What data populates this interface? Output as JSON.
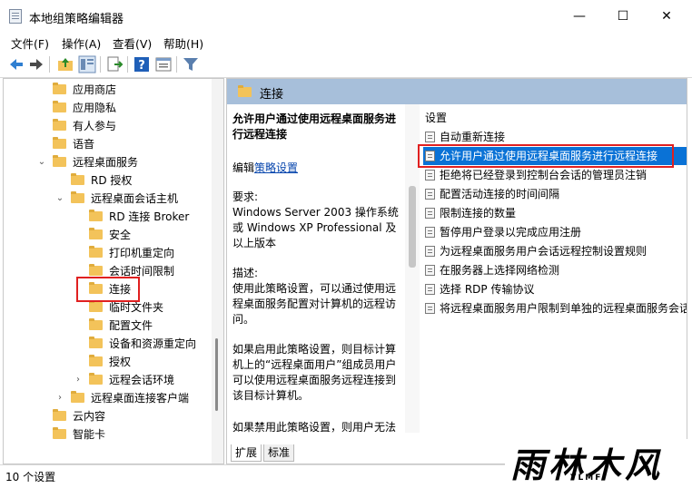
{
  "window": {
    "title": "本地组策略编辑器",
    "minimize": "—",
    "maximize": "☐",
    "close": "✕"
  },
  "menu": [
    {
      "label": "文件(F)"
    },
    {
      "label": "操作(A)"
    },
    {
      "label": "查看(V)"
    },
    {
      "label": "帮助(H)"
    }
  ],
  "toolbar": [
    "back-arrow-icon",
    "forward-arrow-icon",
    "up-folder-icon",
    "show-tree-icon",
    "export-list-icon",
    "help-icon",
    "properties-icon",
    "filter-icon"
  ],
  "tree": {
    "items": [
      {
        "label": "应用商店",
        "level": 0,
        "expander": ""
      },
      {
        "label": "应用隐私",
        "level": 0,
        "expander": ""
      },
      {
        "label": "有人参与",
        "level": 0,
        "expander": ""
      },
      {
        "label": "语音",
        "level": 0,
        "expander": ""
      },
      {
        "label": "远程桌面服务",
        "level": 0,
        "expander": "v"
      },
      {
        "label": "RD 授权",
        "level": 1,
        "expander": ""
      },
      {
        "label": "远程桌面会话主机",
        "level": 1,
        "expander": "v"
      },
      {
        "label": "RD 连接 Broker",
        "level": 2,
        "expander": ""
      },
      {
        "label": "安全",
        "level": 2,
        "expander": ""
      },
      {
        "label": "打印机重定向",
        "level": 2,
        "expander": ""
      },
      {
        "label": "会话时间限制",
        "level": 2,
        "expander": ""
      },
      {
        "label": "连接",
        "level": 2,
        "expander": ""
      },
      {
        "label": "临时文件夹",
        "level": 2,
        "expander": ""
      },
      {
        "label": "配置文件",
        "level": 2,
        "expander": ""
      },
      {
        "label": "设备和资源重定向",
        "level": 2,
        "expander": ""
      },
      {
        "label": "授权",
        "level": 2,
        "expander": ""
      },
      {
        "label": "远程会话环境",
        "level": 2,
        "expander": ">"
      },
      {
        "label": "远程桌面连接客户端",
        "level": 1,
        "expander": ">"
      },
      {
        "label": "云内容",
        "level": 0,
        "expander": ""
      },
      {
        "label": "智能卡",
        "level": 0,
        "expander": ""
      }
    ]
  },
  "right": {
    "header": "连接",
    "description": {
      "title": "允许用户通过使用远程桌面服务进行远程连接",
      "edit_prefix": "编辑",
      "edit_link": "策略设置",
      "requirements_label": "要求:",
      "requirements_text": "Windows Server 2003 操作系统或 Windows XP Professional 及以上版本",
      "desc_label": "描述:",
      "desc_text1": "使用此策略设置，可以通过使用远程桌面服务配置对计算机的远程访问。",
      "desc_text2": "如果启用此策略设置，则目标计算机上的“远程桌面用户”组成员用户可以使用远程桌面服务远程连接到该目标计算机。",
      "desc_text3": "如果禁用此策略设置，则用户无法使用远程桌面服务远程连接到目标"
    },
    "list": {
      "column": "设置",
      "items": [
        {
          "label": "自动重新连接",
          "selected": false
        },
        {
          "label": "允许用户通过使用远程桌面服务进行远程连接",
          "selected": true
        },
        {
          "label": "拒绝将已经登录到控制台会话的管理员注销",
          "selected": false
        },
        {
          "label": "配置活动连接的时间间隔",
          "selected": false
        },
        {
          "label": "限制连接的数量",
          "selected": false
        },
        {
          "label": "暂停用户登录以完成应用注册",
          "selected": false
        },
        {
          "label": "为远程桌面服务用户会话远程控制设置规则",
          "selected": false
        },
        {
          "label": "在服务器上选择网络检测",
          "selected": false
        },
        {
          "label": "选择 RDP 传输协议",
          "selected": false
        },
        {
          "label": "将远程桌面服务用户限制到单独的远程桌面服务会话",
          "selected": false
        }
      ]
    },
    "tabs": [
      {
        "label": "扩展"
      },
      {
        "label": "标准"
      }
    ]
  },
  "status": {
    "text": "10 个设置"
  },
  "watermark": {
    "big": "雨林木风",
    "small": "YLMF"
  },
  "colors": {
    "accent": "#0a72d6",
    "header": "#a7bfda",
    "highlight": "#e02020",
    "folder": "#f3c35a"
  }
}
